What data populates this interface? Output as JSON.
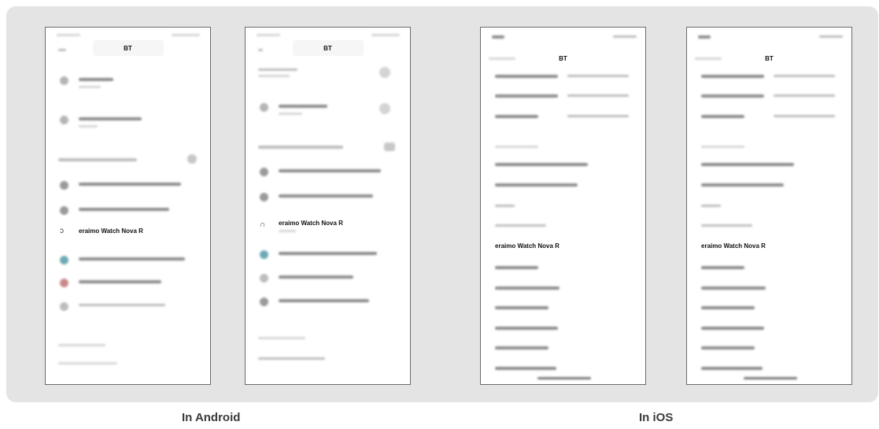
{
  "screens": [
    {
      "platform": "android",
      "title": "BT",
      "highlighted_device": "eraimo Watch Nova R"
    },
    {
      "platform": "android",
      "title": "BT",
      "highlighted_device": "eraimo Watch Nova R"
    },
    {
      "platform": "ios",
      "title": "BT",
      "highlighted_device": "eraimo Watch Nova R"
    },
    {
      "platform": "ios",
      "title": "BT",
      "highlighted_device": "eraimo Watch Nova R"
    }
  ],
  "captions": {
    "android": "In Android",
    "ios": "In iOS"
  },
  "colors": {
    "panel_background": "#e4e4e4",
    "screen_background": "#ffffff",
    "caption_text": "#3c3c3c"
  }
}
